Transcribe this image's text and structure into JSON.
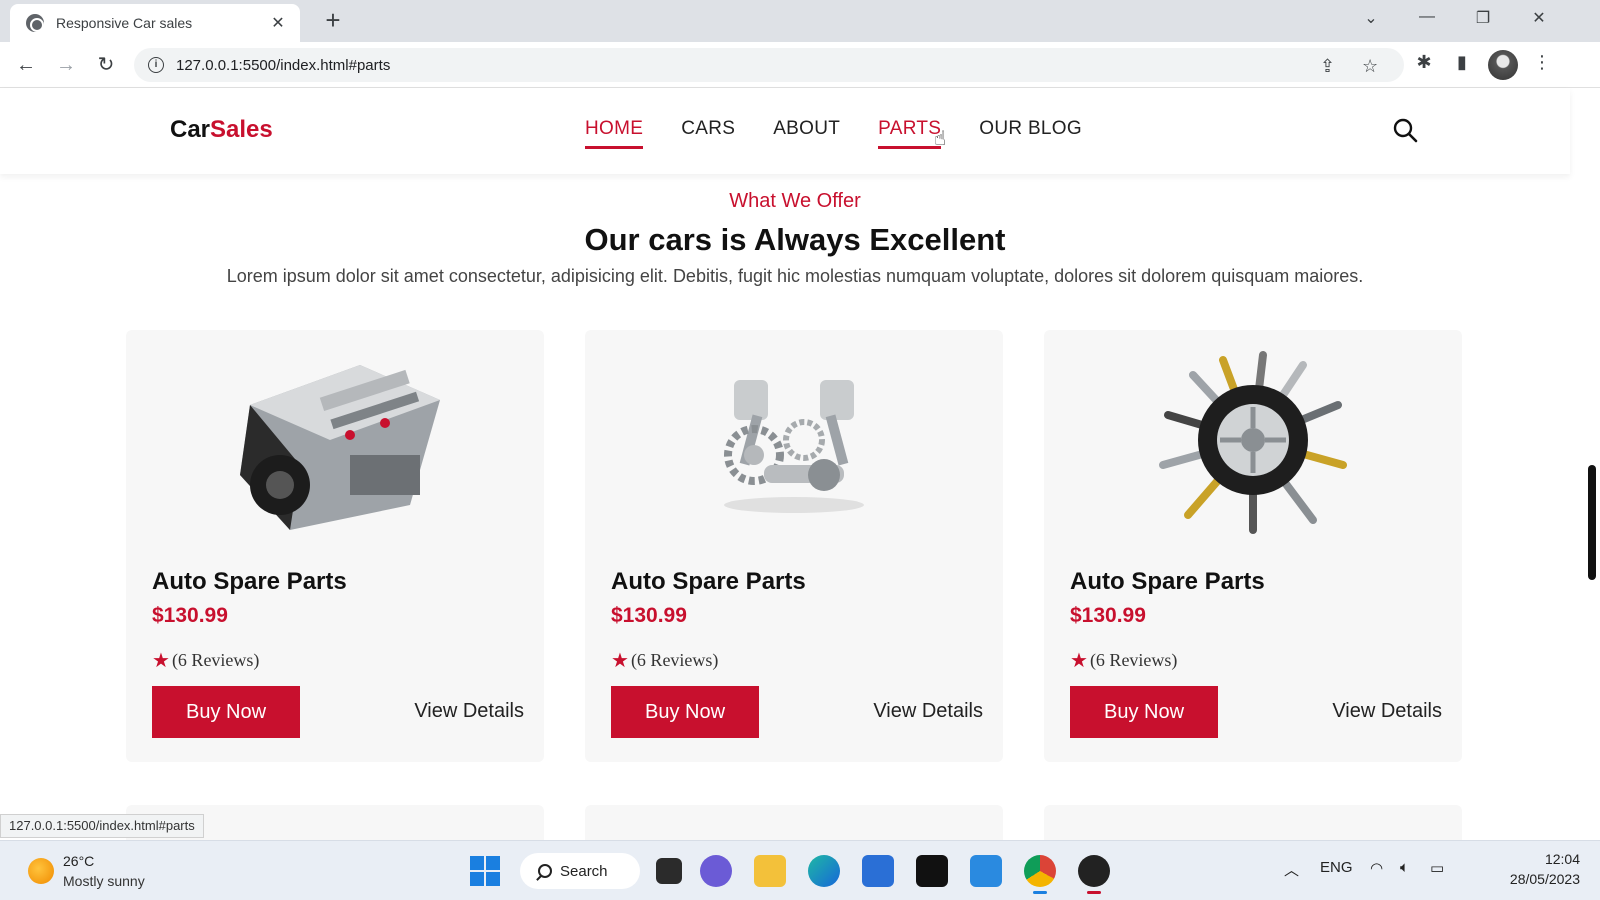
{
  "browser": {
    "tab_title": "Responsive Car sales",
    "tab_close": "✕",
    "new_tab": "+",
    "url": "127.0.0.1:5500/index.html#parts",
    "status_url": "127.0.0.1:5500/index.html#parts"
  },
  "site": {
    "logo": {
      "part1": "Car",
      "part2": "Sales"
    },
    "nav": [
      {
        "label": "HOME",
        "active": true
      },
      {
        "label": "CARS",
        "active": false
      },
      {
        "label": "ABOUT",
        "active": false
      },
      {
        "label": "PARTS",
        "active": true
      },
      {
        "label": "OUR BLOG",
        "active": false
      }
    ]
  },
  "section": {
    "subtitle": "What We Offer",
    "title": "Our cars is Always Excellent",
    "description": "Lorem ipsum dolor sit amet consectetur, adipisicing elit. Debitis, fugit hic molestias numquam voluptate, dolores sit dolorem quisquam maiores."
  },
  "cards": [
    {
      "name": "Auto Spare Parts",
      "price": "$130.99",
      "reviews": "(6  Reviews)",
      "buy_label": "Buy Now",
      "view_label": "View Details",
      "image_icon": "engine-block-icon"
    },
    {
      "name": "Auto Spare Parts",
      "price": "$130.99",
      "reviews": "(6  Reviews)",
      "buy_label": "Buy Now",
      "view_label": "View Details",
      "image_icon": "pistons-crankshaft-icon"
    },
    {
      "name": "Auto Spare Parts",
      "price": "$130.99",
      "reviews": "(6  Reviews)",
      "buy_label": "Buy Now",
      "view_label": "View Details",
      "image_icon": "wheel-tools-icon"
    }
  ],
  "taskbar": {
    "weather_temp": "26°C",
    "weather_desc": "Mostly sunny",
    "search_label": "Search",
    "lang": "ENG",
    "time": "12:04",
    "date": "28/05/2023"
  },
  "colors": {
    "accent": "#c8102e",
    "text": "#111111",
    "card_bg": "#f7f7f7"
  }
}
